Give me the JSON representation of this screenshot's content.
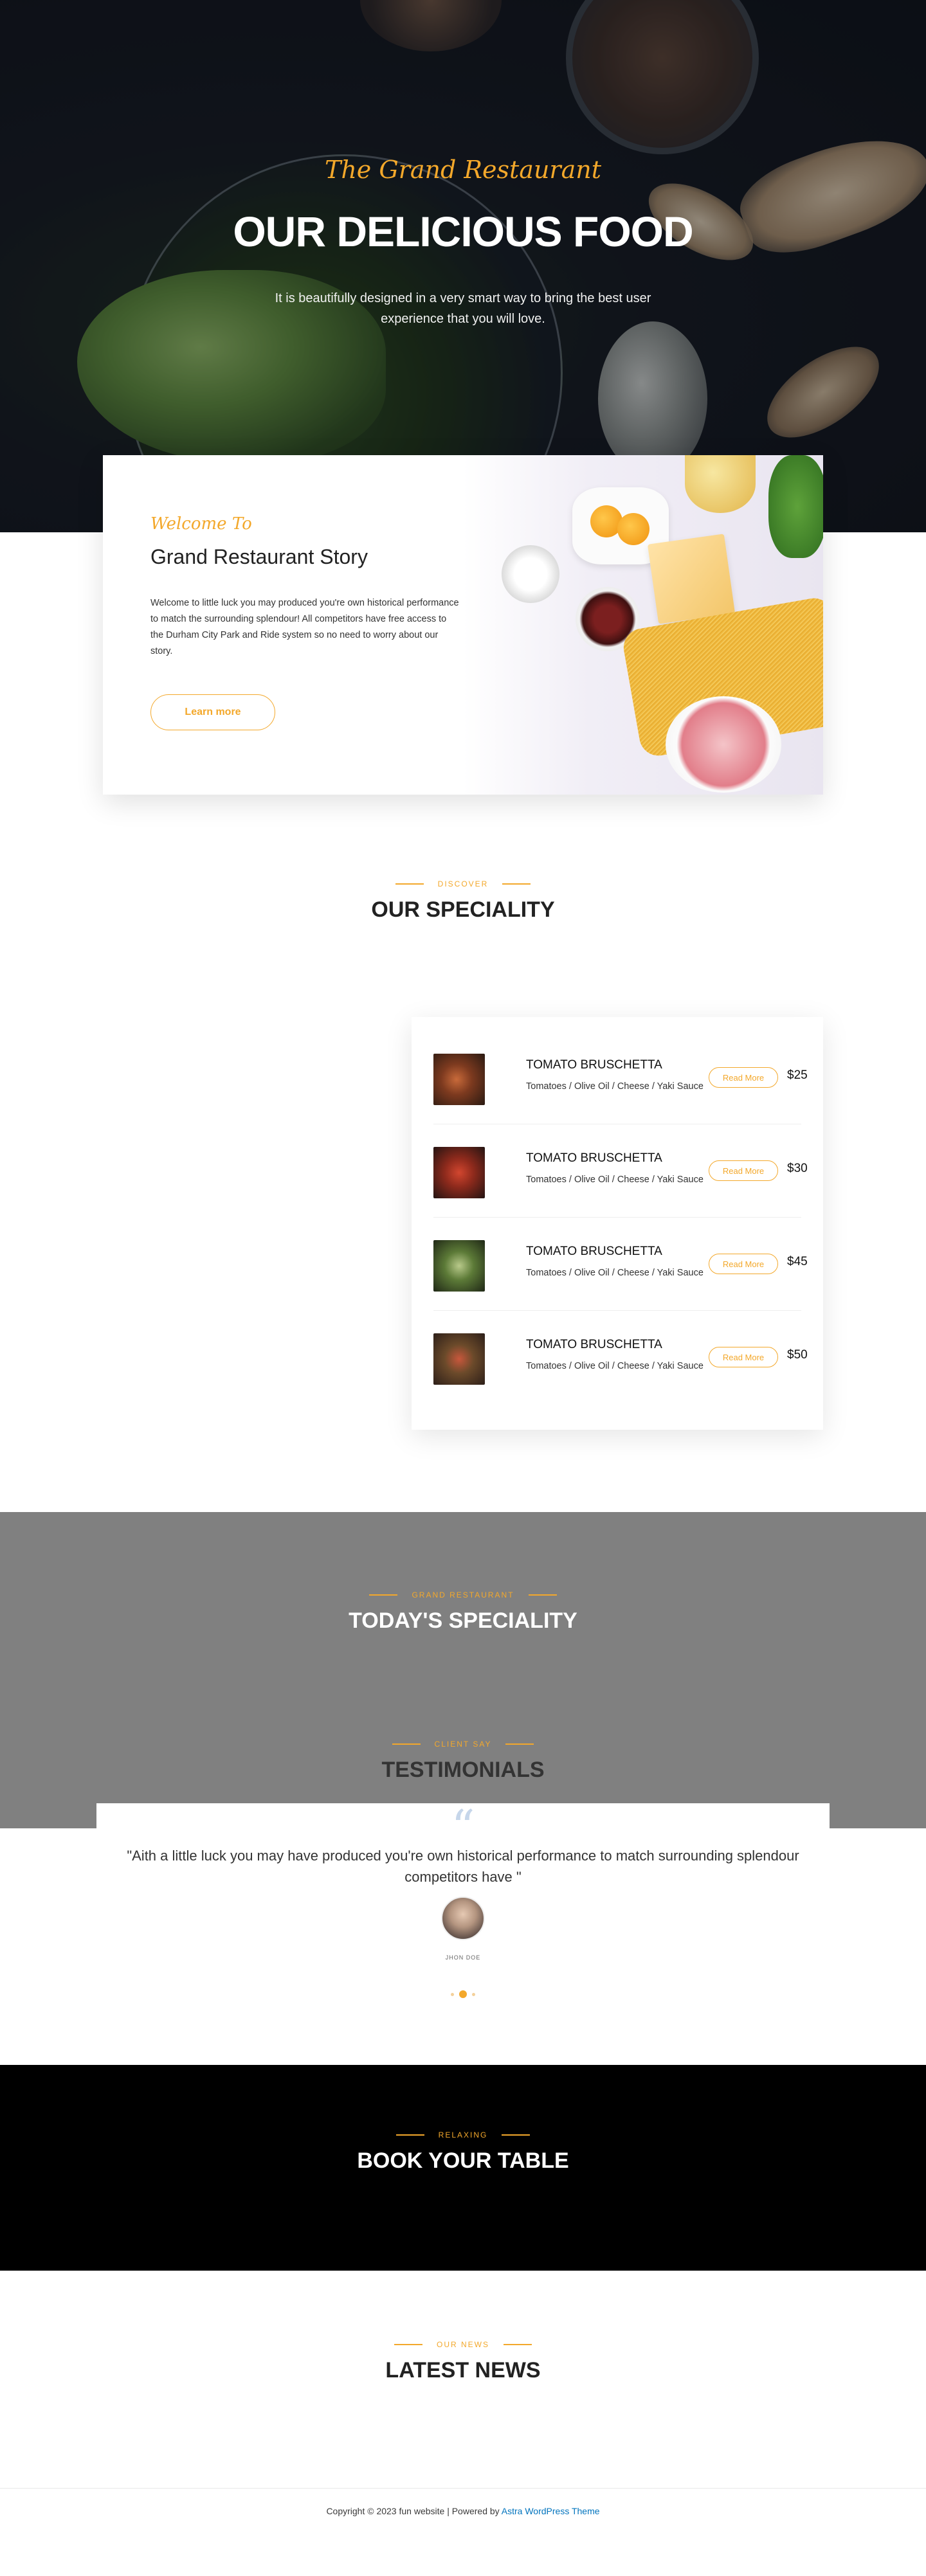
{
  "hero": {
    "script_title": "The Grand Restaurant",
    "title": "OUR DELICIOUS FOOD",
    "subtitle": "It is beautifully designed in a very smart way to bring the best user experience that you will love."
  },
  "story": {
    "script": "Welcome To",
    "heading": "Grand Restaurant Story",
    "body": "Welcome to little luck you may produced you're own historical performance to match the surrounding splendour! All competitors have free access to the Durham City Park and Ride system so no need to worry about our story.",
    "button_label": "Learn more"
  },
  "speciality": {
    "kicker": "DISCOVER",
    "heading": "OUR SPECIALITY",
    "items": [
      {
        "name": "TOMATO BRUSCHETTA",
        "desc": "Tomatoes / Olive Oil / Cheese / Yaki Sauce",
        "button": "Read More",
        "price": "$25"
      },
      {
        "name": "TOMATO BRUSCHETTA",
        "desc": "Tomatoes / Olive Oil / Cheese / Yaki Sauce",
        "button": "Read More",
        "price": "$30"
      },
      {
        "name": "TOMATO BRUSCHETTA",
        "desc": "Tomatoes / Olive Oil / Cheese / Yaki Sauce",
        "button": "Read More",
        "price": "$45"
      },
      {
        "name": "TOMATO BRUSCHETTA",
        "desc": "Tomatoes / Olive Oil / Cheese / Yaki Sauce",
        "button": "Read More",
        "price": "$50"
      }
    ]
  },
  "today": {
    "kicker": "GRAND RESTAURANT",
    "heading": "TODAY'S SPECIALITY"
  },
  "testimonials": {
    "kicker": "CLIENT SAY",
    "heading": "TESTIMONIALS",
    "quote": "\"Aith a little luck you may have produced you're own historical performance to match surrounding splendour competitors have \"",
    "author": "JHON DOE"
  },
  "book": {
    "kicker": "RELAXING",
    "heading": "BOOK YOUR TABLE"
  },
  "news": {
    "kicker": "OUR NEWS",
    "heading": "LATEST NEWS"
  },
  "footer": {
    "text": "Copyright © 2023 fun website | Powered by ",
    "link": "Astra WordPress Theme"
  },
  "colors": {
    "accent": "#f3a82b",
    "today_bg": "#808080",
    "book_bg": "#000000",
    "link": "#0274be"
  }
}
